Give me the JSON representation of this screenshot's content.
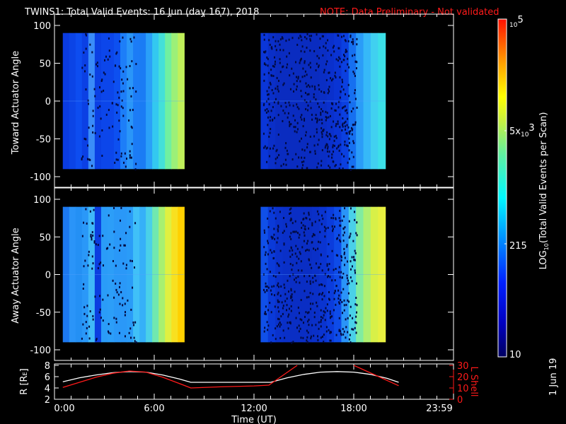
{
  "chart_data": [
    {
      "type": "heatmap",
      "title": "TWINS1: Total Valid Events: 16 Jun (day 167), 2018",
      "note": "NOTE: Data Preliminary - Not validated",
      "ylabel": "Toward Actuator Angle",
      "ylim": [
        -100,
        100
      ],
      "yticks": [
        "100",
        "50",
        "0",
        "-50",
        "-100"
      ],
      "segments": [
        {
          "start_hour": 0.5,
          "end_hour": 7.8,
          "profile": [
            "#0a3be0",
            "#0b44e6",
            "#0d4df0",
            "#0b40e4",
            "#3a8cf8",
            "#0b40e4",
            "#0c46ea",
            "#0c46ea",
            "#0d50f0",
            "#1d7ef8",
            "#2a96f8",
            "#1c7cf6",
            "#1a7cf4",
            "#2aa0f8",
            "#33c8f0",
            "#44e0d8",
            "#70f0a0",
            "#9cf078",
            "#c0f05a"
          ]
        },
        {
          "start_hour": 12.4,
          "end_hour": 19.9,
          "profile": [
            "#0a36d8",
            "#0a2fc8",
            "#0a2cc0",
            "#0a2cc0",
            "#0a2cc0",
            "#0a2cc0",
            "#0a2cc0",
            "#0a2cc0",
            "#0a2ec4",
            "#0a30cc",
            "#0a34d4",
            "#0b40e0",
            "#1670f0",
            "#2a9cf8",
            "#36b8f8",
            "#40d0f0",
            "#3ce0e8"
          ]
        }
      ]
    },
    {
      "type": "heatmap",
      "ylabel": "Away Actuator Angle",
      "ylim": [
        -100,
        100
      ],
      "yticks": [
        "100",
        "50",
        "0",
        "-50",
        "-100"
      ],
      "segments": [
        {
          "start_hour": 0.5,
          "end_hour": 7.8,
          "profile": [
            "#1c78f0",
            "#2a94f8",
            "#2490f4",
            "#2a98f8",
            "#40b8f8",
            "#0b3ee0",
            "#2a9cf8",
            "#2c9ef8",
            "#2a98f8",
            "#2a98f8",
            "#2a9cf8",
            "#40c0f8",
            "#36b0f8",
            "#4ad0e8",
            "#70e8b0",
            "#a8f070",
            "#e0f040",
            "#f8e020",
            "#ffd000"
          ]
        },
        {
          "start_hour": 12.4,
          "end_hour": 19.9,
          "profile": [
            "#1050e8",
            "#0a3ad8",
            "#0a32cc",
            "#0a30c8",
            "#0a2ec4",
            "#0a2ec4",
            "#0a2ec4",
            "#0a30c8",
            "#0a34d0",
            "#0b3cdc",
            "#0e4ce8",
            "#2a94f8",
            "#4ad0e8",
            "#80eca0",
            "#b0f070",
            "#d8f048",
            "#e8f040"
          ]
        }
      ]
    },
    {
      "type": "line",
      "xlabel": "Time (UT)",
      "xlim": [
        0,
        24
      ],
      "xticks": [
        "0:00",
        "6:00",
        "12:00",
        "18:00",
        "23:59"
      ],
      "ylabel_left": "R [R",
      "ylabel_left_sub": "E",
      "ylabel_left_end": "]",
      "ylim_left": [
        2,
        8
      ],
      "yticks_left": [
        "8",
        "6",
        "4",
        "2"
      ],
      "ylabel_right": "L Shell",
      "ylim_right": [
        0,
        30
      ],
      "yticks_right": [
        "30",
        "20",
        "10",
        "0"
      ],
      "series": [
        {
          "name": "R",
          "color": "#ffffff",
          "axis": "left",
          "x": [
            0.5,
            1.5,
            2.5,
            3.5,
            4.5,
            5.5,
            6.5,
            7.5,
            8.2,
            10,
            13,
            14,
            15,
            16,
            17,
            18,
            19,
            20,
            20.7
          ],
          "y": [
            5.1,
            5.8,
            6.3,
            6.7,
            6.9,
            6.8,
            6.3,
            5.6,
            5.0,
            5.0,
            5.0,
            5.8,
            6.4,
            6.8,
            6.9,
            6.8,
            6.4,
            5.7,
            5.0
          ]
        },
        {
          "name": "L Shell",
          "color": "#ff1a1a",
          "axis": "right",
          "x": [
            0.5,
            1.5,
            2.5,
            3.5,
            4.5,
            5.5,
            6.5,
            7.5,
            8.2,
            10,
            12,
            12.9,
            14.6,
            null,
            18.0,
            19.5,
            20.7
          ],
          "y": [
            10.5,
            15,
            19.5,
            23,
            25,
            24,
            19.5,
            14,
            10,
            11,
            11.8,
            12.5,
            30,
            null,
            30,
            20,
            12
          ]
        }
      ]
    }
  ],
  "colorbar": {
    "label_main": "LOG",
    "label_sub": "10",
    "label_rest": "(Total Valid Events per Scan)",
    "ticks": [
      {
        "base": "10",
        "sup": "5",
        "prefix": ""
      },
      {
        "base": "10",
        "sup": "3",
        "prefix": "5x"
      },
      {
        "base": "215",
        "sup": "",
        "prefix": ""
      },
      {
        "base": "10",
        "sup": "",
        "prefix": ""
      }
    ],
    "range": [
      10,
      100000
    ]
  },
  "date_stamp": "1 Jun 19"
}
